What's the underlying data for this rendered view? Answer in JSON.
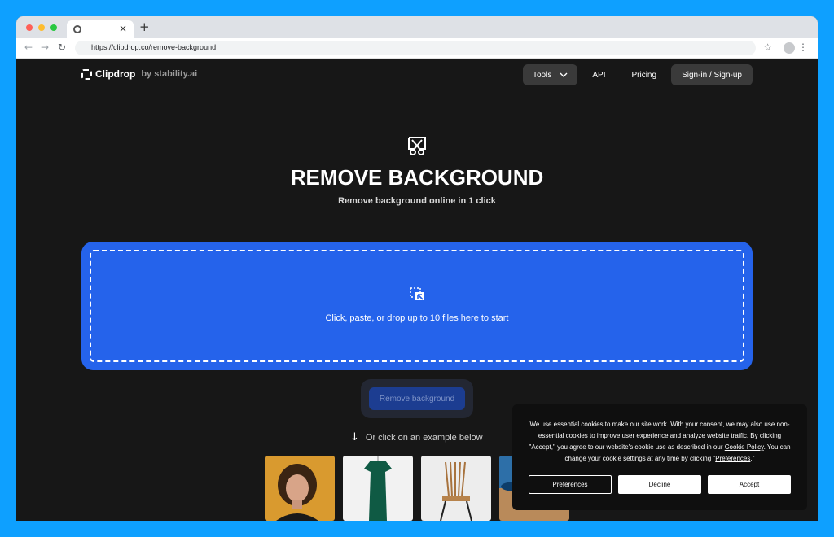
{
  "browser": {
    "tab_close": "×",
    "new_tab": "+",
    "back": "←",
    "forward": "→",
    "reload": "↻",
    "url": "https://clipdrop.co/remove-background",
    "star": "☆",
    "kebab": "⋮"
  },
  "header": {
    "logo_name": "Clipdrop",
    "logo_by": "by stability.ai",
    "nav": {
      "tools": "Tools",
      "api": "API",
      "pricing": "Pricing",
      "signin": "Sign-in / Sign-up"
    }
  },
  "hero": {
    "title": "REMOVE BACKGROUND",
    "subtitle": "Remove background online in 1 click"
  },
  "dropzone": {
    "text": "Click, paste, or drop up to 10 files here to start"
  },
  "actions": {
    "remove_button": "Remove background"
  },
  "examples": {
    "hint": "Or click on an example below",
    "items": [
      "woman portrait",
      "green dress",
      "wooden chair",
      "beach scene"
    ]
  },
  "cookie": {
    "text_1": "We use essential cookies to make our site work. With your consent, we may also use non-essential cookies to improve user experience and analyze website traffic. By clicking \"Accept,\" you agree to our website's cookie use as described in our ",
    "policy_link": "Cookie Policy",
    "text_2": ". You can change your cookie settings at any time by clicking \"",
    "preferences_link": "Preferences",
    "text_3": ".\"",
    "btn_preferences": "Preferences",
    "btn_decline": "Decline",
    "btn_accept": "Accept"
  },
  "colors": {
    "page_bg": "#171717",
    "dropzone": "#2563eb",
    "frame": "#0ea0ff"
  }
}
